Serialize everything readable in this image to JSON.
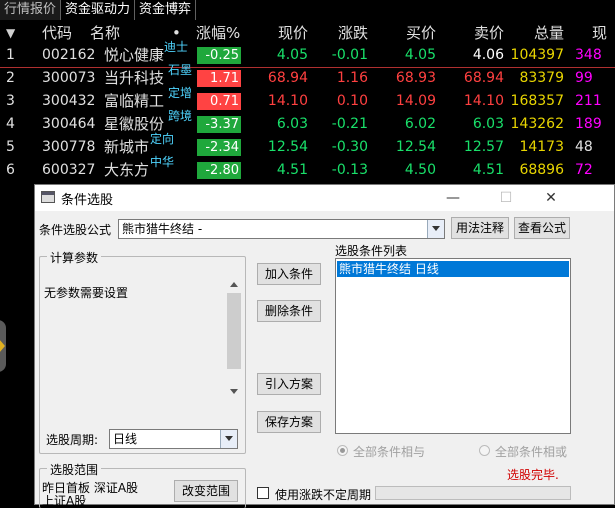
{
  "tabs": [
    "行情报价",
    "资金驱动力",
    "资金博弈"
  ],
  "table": {
    "headers": {
      "code": "代码",
      "name": "名称",
      "dot": "•",
      "pct": "涨幅%",
      "price": "现价",
      "chg": "涨跌",
      "buy": "买价",
      "sell": "卖价",
      "vol": "总量",
      "amt": "现"
    },
    "sort_marker": "▼",
    "rows": [
      {
        "idx": "1",
        "code": "002162",
        "name": "悦心健康",
        "tag": "迪士",
        "pct": "-0.25",
        "dir": "dn",
        "price": "4.05",
        "chg": "-0.01",
        "buy": "4.05",
        "sell": "4.06",
        "vol": "104397",
        "amt": "348"
      },
      {
        "idx": "2",
        "code": "300073",
        "name": "当升科技",
        "tag": "石墨",
        "pct": "1.71",
        "dir": "up",
        "price": "68.94",
        "chg": "1.16",
        "buy": "68.93",
        "sell": "68.94",
        "vol": "83379",
        "amt": "99"
      },
      {
        "idx": "3",
        "code": "300432",
        "name": "富临精工",
        "tag": "定增",
        "pct": "0.71",
        "dir": "up",
        "price": "14.10",
        "chg": "0.10",
        "buy": "14.09",
        "sell": "14.10",
        "vol": "168357",
        "amt": "211"
      },
      {
        "idx": "4",
        "code": "300464",
        "name": "星徽股份",
        "tag": "跨境",
        "pct": "-3.37",
        "dir": "dn",
        "price": "6.03",
        "chg": "-0.21",
        "buy": "6.02",
        "sell": "6.03",
        "vol": "143262",
        "amt": "189"
      },
      {
        "idx": "5",
        "code": "300778",
        "name": "新城市",
        "tag": "定向",
        "pct": "-2.34",
        "dir": "dn",
        "price": "12.54",
        "chg": "-0.30",
        "buy": "12.54",
        "sell": "12.57",
        "vol": "14173",
        "amt": "48"
      },
      {
        "idx": "6",
        "code": "600327",
        "name": "大东方",
        "tag": "中华",
        "pct": "-2.80",
        "dir": "dn",
        "price": "4.51",
        "chg": "-0.13",
        "buy": "4.50",
        "sell": "4.51",
        "vol": "68896",
        "amt": "72"
      }
    ]
  },
  "dialog": {
    "title": "条件选股",
    "minimize": "—",
    "maximize": "☐",
    "close": "✕",
    "formula_label": "条件选股公式",
    "formula_value": "熊市猎牛终结 -",
    "usage_button": "用法注释",
    "view_formula_button": "查看公式",
    "params_group": "计算参数",
    "no_params_text": "无参数需要设置",
    "period_label": "选股周期:",
    "period_value": "日线",
    "range_group": "选股范围",
    "range_text": "昨日首板 深证A股 上证A股",
    "change_range_button": "改变范围",
    "add_condition_button": "加入条件",
    "delete_condition_button": "删除条件",
    "import_plan_button": "引入方案",
    "save_plan_button": "保存方案",
    "condition_list_label": "选股条件列表",
    "condition_items": [
      "熊市猎牛终结  日线"
    ],
    "radio_and": "全部条件相与",
    "radio_or": "全部条件相或",
    "status": "选股完毕.",
    "uncertain_period_label": "使用涨跌不定周期"
  },
  "colors": {
    "up": "#ff4343",
    "down": "#1fa83c",
    "volume": "#e8d500",
    "amount": "#ff00ff",
    "tag": "#4fd5ff",
    "status": "#d00000"
  }
}
